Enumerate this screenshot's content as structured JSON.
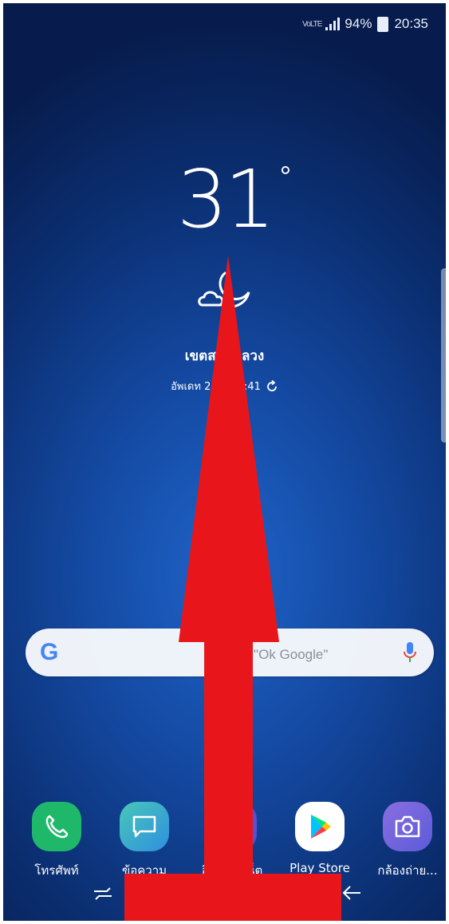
{
  "status_bar": {
    "vowifi": "VoLTE",
    "battery": "94%",
    "time": "20:35"
  },
  "weather": {
    "temperature": "31",
    "degree_symbol": "°",
    "condition_icon": "moon-cloud-icon",
    "location": "เขตสวนหลวง",
    "updated": "อัพเดท 24/7 17:41"
  },
  "search": {
    "hint": "พูดว่า \"Ok Google\"",
    "logo": "G"
  },
  "dock": {
    "apps": [
      {
        "label": "โทรศัพท์",
        "icon": "phone-icon",
        "color": "#1fb86b"
      },
      {
        "label": "ข้อความ",
        "icon": "message-icon",
        "color": "#2fa8d8"
      },
      {
        "label": "อินเทอร์เน็ต",
        "icon": "internet-icon",
        "color": "#5b4fd1"
      },
      {
        "label": "Play Store",
        "icon": "play-store-icon",
        "color": "#ffffff"
      },
      {
        "label": "กล้องถ่าย...",
        "icon": "camera-icon",
        "color": "#7a5bd6"
      }
    ]
  },
  "nav": {
    "recents": "recents-icon",
    "back": "back-icon"
  },
  "annotation": {
    "arrow_color": "#e8161b",
    "direction": "up"
  }
}
